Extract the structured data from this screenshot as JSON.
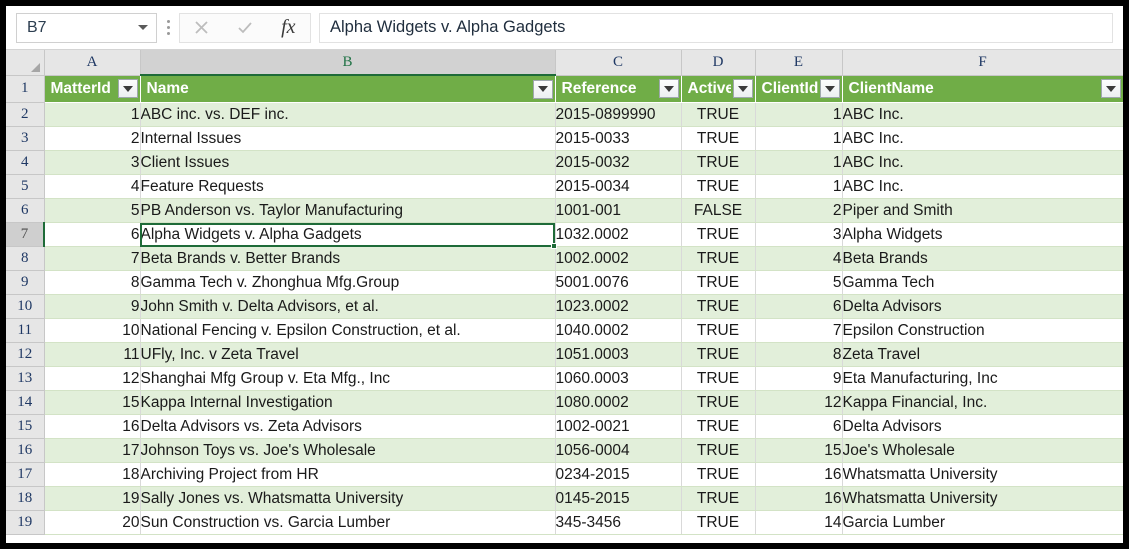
{
  "formula_bar": {
    "name_box_value": "B7",
    "cancel_icon": "close-icon",
    "confirm_icon": "check-icon",
    "function_icon": "fx-icon",
    "function_label": "fx",
    "formula_value": "Alpha Widgets v. Alpha Gadgets",
    "formula_placeholder": ""
  },
  "grid": {
    "column_letters": [
      "A",
      "B",
      "C",
      "D",
      "E",
      "F"
    ],
    "active_column": "B",
    "active_row": "7",
    "selected_cell": "B7",
    "header_row_number": "1",
    "headers": [
      "MatterId",
      "Name",
      "Reference",
      "Active",
      "ClientId",
      "ClientName"
    ],
    "filter_icon": "filter-dropdown-icon",
    "row_numbers": [
      "2",
      "3",
      "4",
      "5",
      "6",
      "7",
      "8",
      "9",
      "10",
      "11",
      "12",
      "13",
      "14",
      "15",
      "16",
      "17",
      "18",
      "19"
    ],
    "rows": [
      {
        "n": "2",
        "MatterId": "1",
        "Name": "ABC inc. vs. DEF inc.",
        "Reference": "2015-0899990",
        "Active": "TRUE",
        "ClientId": "1",
        "ClientName": "ABC Inc."
      },
      {
        "n": "3",
        "MatterId": "2",
        "Name": "Internal Issues",
        "Reference": "2015-0033",
        "Active": "TRUE",
        "ClientId": "1",
        "ClientName": "ABC Inc."
      },
      {
        "n": "4",
        "MatterId": "3",
        "Name": "Client Issues",
        "Reference": "2015-0032",
        "Active": "TRUE",
        "ClientId": "1",
        "ClientName": "ABC Inc."
      },
      {
        "n": "5",
        "MatterId": "4",
        "Name": "Feature Requests",
        "Reference": "2015-0034",
        "Active": "TRUE",
        "ClientId": "1",
        "ClientName": "ABC Inc."
      },
      {
        "n": "6",
        "MatterId": "5",
        "Name": "PB Anderson vs. Taylor Manufacturing",
        "Reference": "1001-001",
        "Active": "FALSE",
        "ClientId": "2",
        "ClientName": "Piper and Smith"
      },
      {
        "n": "7",
        "MatterId": "6",
        "Name": "Alpha Widgets v. Alpha Gadgets",
        "Reference": "1032.0002",
        "Active": "TRUE",
        "ClientId": "3",
        "ClientName": "Alpha Widgets"
      },
      {
        "n": "8",
        "MatterId": "7",
        "Name": "Beta Brands v. Better Brands",
        "Reference": "1002.0002",
        "Active": "TRUE",
        "ClientId": "4",
        "ClientName": "Beta Brands"
      },
      {
        "n": "9",
        "MatterId": "8",
        "Name": "Gamma Tech v. Zhonghua Mfg.Group",
        "Reference": "5001.0076",
        "Active": "TRUE",
        "ClientId": "5",
        "ClientName": "Gamma Tech"
      },
      {
        "n": "10",
        "MatterId": "9",
        "Name": "John Smith v. Delta Advisors, et al.",
        "Reference": "1023.0002",
        "Active": "TRUE",
        "ClientId": "6",
        "ClientName": "Delta Advisors"
      },
      {
        "n": "11",
        "MatterId": "10",
        "Name": "National Fencing v. Epsilon Construction, et al.",
        "Reference": "1040.0002",
        "Active": "TRUE",
        "ClientId": "7",
        "ClientName": "Epsilon Construction"
      },
      {
        "n": "12",
        "MatterId": "11",
        "Name": "UFly, Inc. v Zeta Travel",
        "Reference": "1051.0003",
        "Active": "TRUE",
        "ClientId": "8",
        "ClientName": "Zeta Travel"
      },
      {
        "n": "13",
        "MatterId": "12",
        "Name": "Shanghai Mfg Group v. Eta Mfg., Inc",
        "Reference": "1060.0003",
        "Active": "TRUE",
        "ClientId": "9",
        "ClientName": "Eta Manufacturing, Inc"
      },
      {
        "n": "14",
        "MatterId": "15",
        "Name": "Kappa Internal Investigation",
        "Reference": "1080.0002",
        "Active": "TRUE",
        "ClientId": "12",
        "ClientName": "Kappa Financial, Inc."
      },
      {
        "n": "15",
        "MatterId": "16",
        "Name": "Delta Advisors vs. Zeta Advisors",
        "Reference": "1002-0021",
        "Active": "TRUE",
        "ClientId": "6",
        "ClientName": "Delta Advisors"
      },
      {
        "n": "16",
        "MatterId": "17",
        "Name": "Johnson Toys vs. Joe's Wholesale",
        "Reference": "1056-0004",
        "Active": "TRUE",
        "ClientId": "15",
        "ClientName": "Joe's Wholesale"
      },
      {
        "n": "17",
        "MatterId": "18",
        "Name": "Archiving Project from HR",
        "Reference": "0234-2015",
        "Active": "TRUE",
        "ClientId": "16",
        "ClientName": "Whatsmatta University"
      },
      {
        "n": "18",
        "MatterId": "19",
        "Name": "Sally Jones vs. Whatsmatta University",
        "Reference": "0145-2015",
        "Active": "TRUE",
        "ClientId": "16",
        "ClientName": "Whatsmatta University"
      },
      {
        "n": "19",
        "MatterId": "20",
        "Name": "Sun Construction vs. Garcia Lumber",
        "Reference": "345-3456",
        "Active": "TRUE",
        "ClientId": "14",
        "ClientName": "Garcia Lumber"
      }
    ]
  },
  "colors": {
    "table_header_green": "#70AD47",
    "band_green": "#E2EFDA",
    "selection_green": "#1E6B38",
    "row_header_gray": "#E6E6E6"
  }
}
